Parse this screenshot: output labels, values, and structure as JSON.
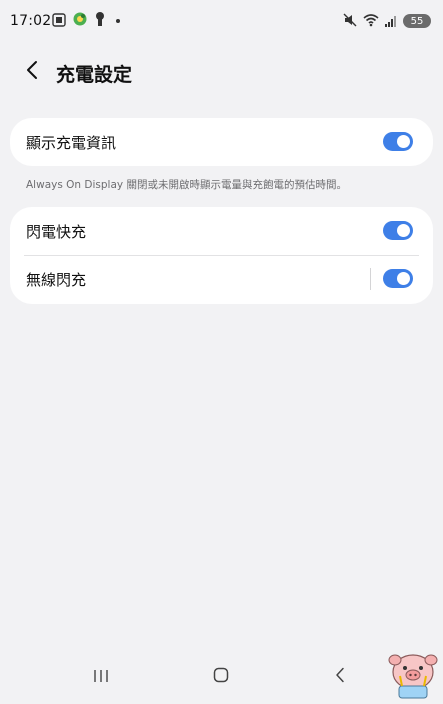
{
  "status_bar": {
    "time": "17:02",
    "battery": "55",
    "icons_left": [
      "screenshot-icon",
      "location-icon",
      "key-icon",
      "notification-dot"
    ],
    "icons_right": [
      "mute-icon",
      "wifi-icon",
      "signal-icon",
      "battery-icon"
    ]
  },
  "header": {
    "title": "充電設定",
    "back_icon": "chevron-left-icon"
  },
  "settings": {
    "card1": {
      "item1": {
        "label": "顯示充電資訊",
        "enabled": true
      }
    },
    "description": "Always On Display 關閉或未開啟時顯示電量與充飽電的預估時間。",
    "card2": {
      "item1": {
        "label": "閃電快充",
        "enabled": true
      },
      "item2": {
        "label": "無線閃充",
        "enabled": true
      }
    }
  },
  "nav": {
    "recents_icon": "recents-icon",
    "home_icon": "home-icon",
    "back_icon": "back-icon"
  },
  "colors": {
    "background": "#f2f2f4",
    "card": "#ffffff",
    "toggle_on": "#3e7fe7",
    "text_primary": "#111111",
    "text_secondary": "#6d6d70"
  }
}
